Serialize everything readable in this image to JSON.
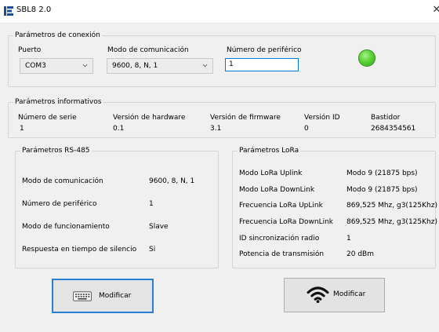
{
  "window": {
    "title": "SBL8 2.0",
    "close_glyph": "✕"
  },
  "connection": {
    "title": "Parámetros de conexión",
    "port_label": "Puerto",
    "port_value": "COM3",
    "comm_mode_label": "Modo de comunicación",
    "comm_mode_value": "9600, 8, N, 1",
    "peripheral_label": "Número de periférico",
    "peripheral_value": "1",
    "status_led_color": "#5ad436"
  },
  "info": {
    "title": "Parámetros informativos",
    "columns": [
      {
        "label": "Número de serie",
        "value": "1"
      },
      {
        "label": "Versión de hardware",
        "value": "0.1"
      },
      {
        "label": "Versión de firmware",
        "value": "3.1"
      },
      {
        "label": "Versión ID",
        "value": "0"
      },
      {
        "label": "Bastidor",
        "value": "2684354561"
      }
    ]
  },
  "rs485": {
    "title": "Parámetros RS-485",
    "rows": [
      {
        "label": "Modo de comunicación",
        "value": "9600, 8, N, 1"
      },
      {
        "label": "Número de periférico",
        "value": "1"
      },
      {
        "label": "Modo de funcionamiento",
        "value": "Slave"
      },
      {
        "label": "Respuesta en tiempo de silencio",
        "value": "Si"
      }
    ],
    "button_label": "Modificar",
    "button_icon": "keyboard-icon"
  },
  "lora": {
    "title": "Parámetros LoRa",
    "rows": [
      {
        "label": "Modo LoRa Uplink",
        "value": "Modo 9 (21875 bps)"
      },
      {
        "label": "Modo LoRa DownLink",
        "value": "Modo 9 (21875 bps)"
      },
      {
        "label": "Frecuencia LoRa UpLink",
        "value": "869,525 Mhz, g3(125Khz)"
      },
      {
        "label": "Frecuencia LoRa DownLink",
        "value": "869,525 Mhz, g3(125Khz)"
      },
      {
        "label": "ID sincronización radio",
        "value": "1"
      },
      {
        "label": "Potencia de transmisión",
        "value": "20 dBm"
      }
    ],
    "button_label": "Modificar",
    "button_icon": "wifi-icon"
  }
}
